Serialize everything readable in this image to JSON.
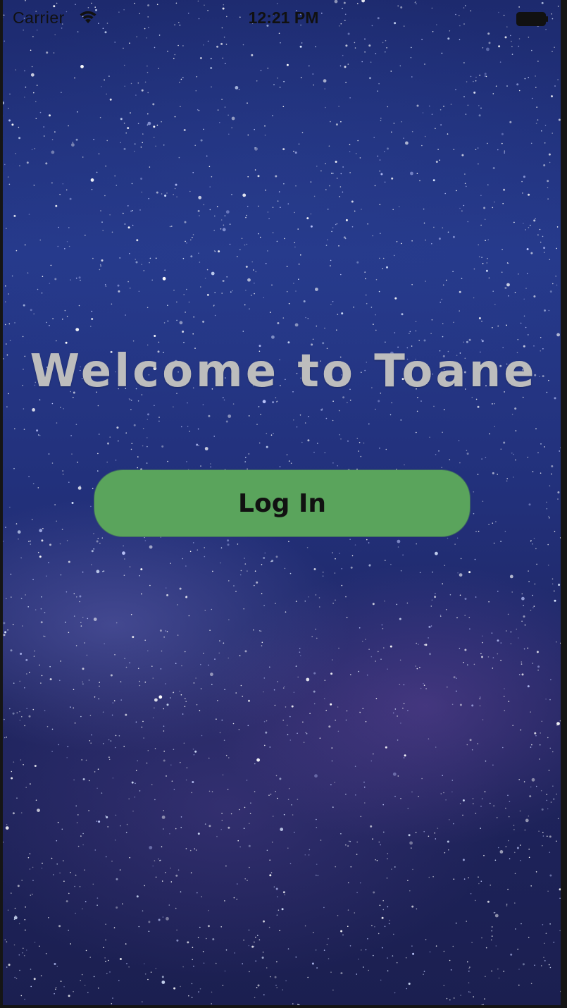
{
  "status_bar": {
    "carrier": "Carrier",
    "wifi_icon": "wifi-icon",
    "time": "12:21 PM",
    "battery_icon": "battery-icon"
  },
  "main": {
    "title": "Welcome to Toane",
    "login_button_label": "Log In"
  },
  "colors": {
    "button": "#5aa45c",
    "title_text": "#bdbdbd",
    "background": "#22307a"
  }
}
